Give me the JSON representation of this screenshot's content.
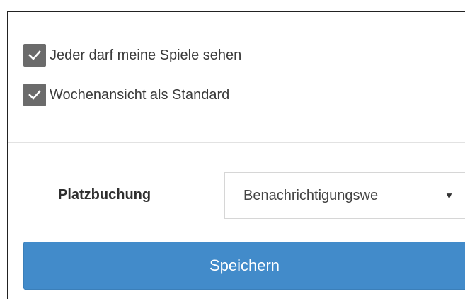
{
  "checkboxes": [
    {
      "label": "Jeder darf meine Spiele sehen",
      "checked": true
    },
    {
      "label": "Wochenansicht als Standard",
      "checked": true
    }
  ],
  "booking": {
    "label": "Platzbuchung",
    "select_value": "Benachrichtigungswe",
    "arrow_icon": "caret-down-icon"
  },
  "save_button": {
    "label": "Speichern"
  },
  "colors": {
    "primary": "#428bca",
    "checkbox": "#6b6b6b",
    "divider": "#e2e2e2"
  }
}
